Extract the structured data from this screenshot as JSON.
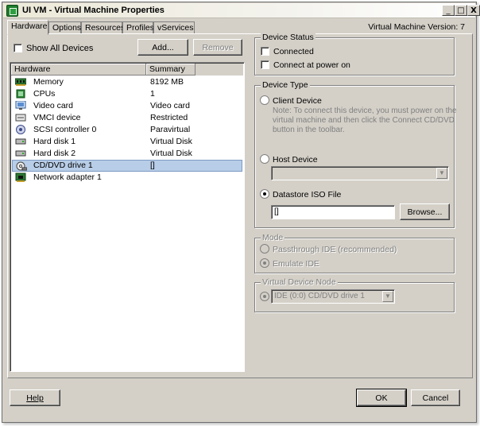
{
  "window": {
    "title": "UI VM - Virtual Machine Properties",
    "controls": {
      "minimize": "_",
      "maximize": "□",
      "close": "X"
    }
  },
  "tabs": [
    {
      "label": "Hardware",
      "active": true
    },
    {
      "label": "Options",
      "active": false
    },
    {
      "label": "Resources",
      "active": false
    },
    {
      "label": "Profiles",
      "active": false
    },
    {
      "label": "vServices",
      "active": false
    }
  ],
  "version_label": "Virtual Machine Version: 7",
  "show_all_devices": {
    "label": "Show All Devices",
    "checked": false
  },
  "buttons": {
    "add": "Add...",
    "remove": "Remove",
    "browse": "Browse...",
    "help": "Help",
    "ok": "OK",
    "cancel": "Cancel"
  },
  "hardware_table": {
    "columns": [
      "Hardware",
      "Summary"
    ],
    "rows": [
      {
        "icon": "memory-icon",
        "name": "Memory",
        "summary": "8192 MB",
        "selected": false
      },
      {
        "icon": "cpu-icon",
        "name": "CPUs",
        "summary": "1",
        "selected": false
      },
      {
        "icon": "monitor-icon",
        "name": "Video card",
        "summary": "Video card",
        "selected": false
      },
      {
        "icon": "vmci-icon",
        "name": "VMCI device",
        "summary": "Restricted",
        "selected": false
      },
      {
        "icon": "scsi-icon",
        "name": "SCSI controller 0",
        "summary": "Paravirtual",
        "selected": false
      },
      {
        "icon": "harddisk-icon",
        "name": "Hard disk 1",
        "summary": "Virtual Disk",
        "selected": false
      },
      {
        "icon": "harddisk-icon",
        "name": "Hard disk 2",
        "summary": "Virtual Disk",
        "selected": false
      },
      {
        "icon": "cd-drive-icon",
        "name": "CD/DVD drive 1",
        "summary": "[]",
        "selected": true
      },
      {
        "icon": "network-adapter-icon",
        "name": "Network adapter 1",
        "summary": "",
        "selected": false
      }
    ]
  },
  "device_status": {
    "title": "Device Status",
    "connected": {
      "label": "Connected",
      "checked": false
    },
    "connect_at_power_on": {
      "label": "Connect at power on",
      "checked": false
    }
  },
  "device_type": {
    "title": "Device Type",
    "client_device": {
      "label": "Client Device",
      "checked": false,
      "note_line1": "Note: To connect this device, you must power on the",
      "note_line2": "virtual machine and then click the Connect CD/DVD",
      "note_line3": "button in the toolbar."
    },
    "host_device": {
      "label": "Host Device",
      "checked": false,
      "value": ""
    },
    "datastore_iso": {
      "label": "Datastore ISO File",
      "checked": true,
      "value": "[]"
    }
  },
  "mode": {
    "title": "Mode",
    "passthrough": {
      "label": "Passthrough IDE (recommended)",
      "checked": false
    },
    "emulate": {
      "label": "Emulate IDE",
      "checked": true
    }
  },
  "virtual_device_node": {
    "title": "Virtual Device Node",
    "value": "IDE (0:0) CD/DVD drive 1"
  },
  "colors": {
    "window_bg": "#d4d0c8",
    "selection": "#b8cde7",
    "disabled_text": "#808080"
  }
}
